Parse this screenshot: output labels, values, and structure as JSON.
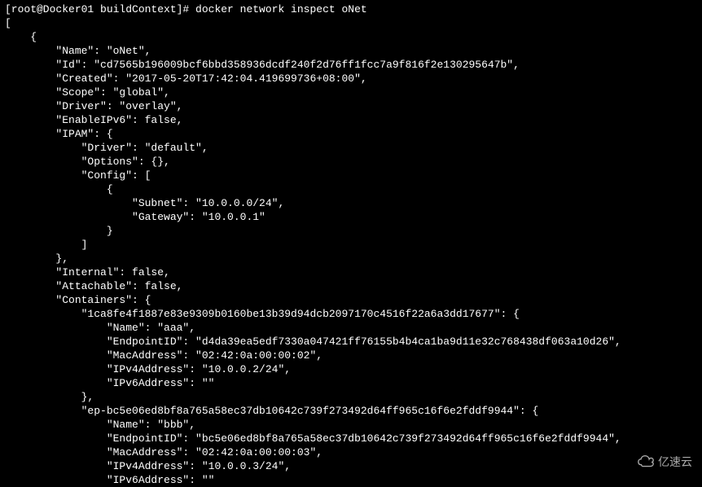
{
  "prompt": "[root@Docker01 buildContext]# docker network inspect oNet",
  "lines": [
    "[",
    "    {",
    "        \"Name\": \"oNet\",",
    "        \"Id\": \"cd7565b196009bcf6bbd358936dcdf240f2d76ff1fcc7a9f816f2e130295647b\",",
    "        \"Created\": \"2017-05-20T17:42:04.419699736+08:00\",",
    "        \"Scope\": \"global\",",
    "        \"Driver\": \"overlay\",",
    "        \"EnableIPv6\": false,",
    "        \"IPAM\": {",
    "            \"Driver\": \"default\",",
    "            \"Options\": {},",
    "            \"Config\": [",
    "                {",
    "                    \"Subnet\": \"10.0.0.0/24\",",
    "                    \"Gateway\": \"10.0.0.1\"",
    "                }",
    "            ]",
    "        },",
    "        \"Internal\": false,",
    "        \"Attachable\": false,",
    "        \"Containers\": {",
    "            \"1ca8fe4f1887e83e9309b0160be13b39d94dcb2097170c4516f22a6a3dd17677\": {",
    "                \"Name\": \"aaa\",",
    "                \"EndpointID\": \"d4da39ea5edf7330a047421ff76155b4b4ca1ba9d11e32c768438df063a10d26\",",
    "                \"MacAddress\": \"02:42:0a:00:00:02\",",
    "                \"IPv4Address\": \"10.0.0.2/24\",",
    "                \"IPv6Address\": \"\"",
    "            },",
    "            \"ep-bc5e06ed8bf8a765a58ec37db10642c739f273492d64ff965c16f6e2fddf9944\": {",
    "                \"Name\": \"bbb\",",
    "                \"EndpointID\": \"bc5e06ed8bf8a765a58ec37db10642c739f273492d64ff965c16f6e2fddf9944\",",
    "                \"MacAddress\": \"02:42:0a:00:00:03\",",
    "                \"IPv4Address\": \"10.0.0.3/24\",",
    "                \"IPv6Address\": \"\""
  ],
  "watermark": {
    "text": "亿速云"
  }
}
